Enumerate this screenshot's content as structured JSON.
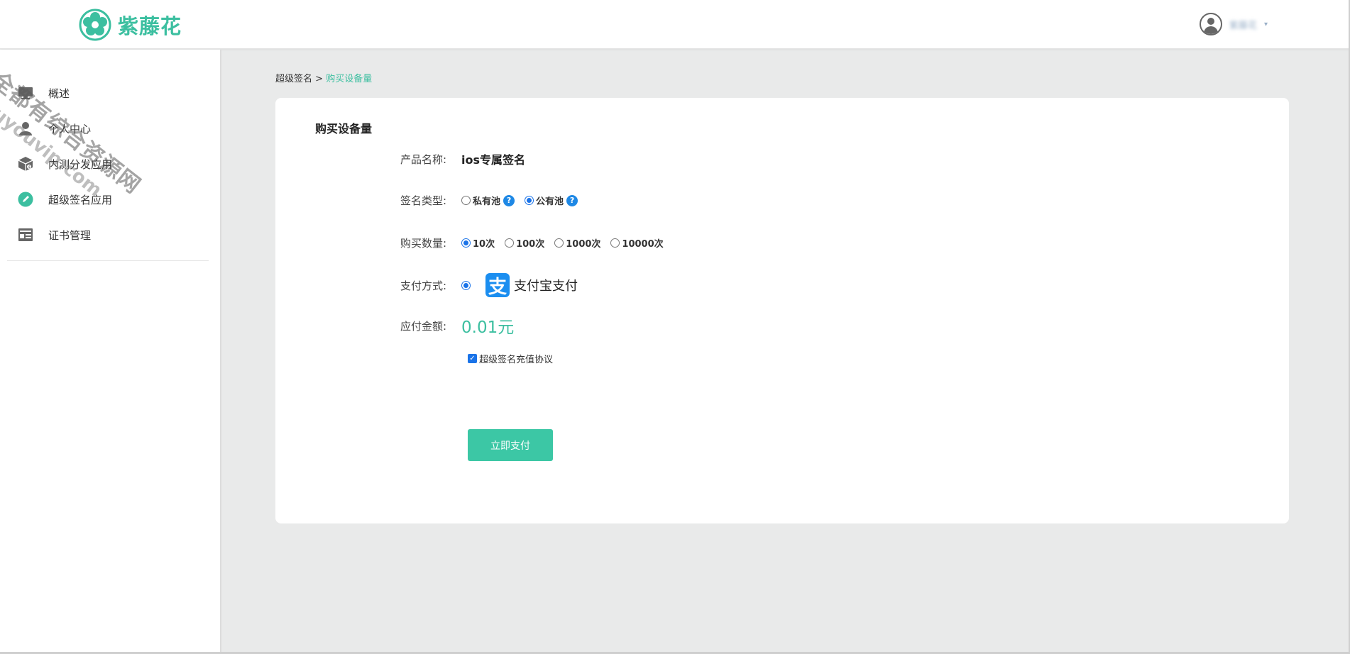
{
  "header": {
    "logo_text": "紫藤花",
    "username": "紫藤花",
    "caret": "▾"
  },
  "watermark": {
    "line1": "全都有综合资源网",
    "line2": "douyouvip.com"
  },
  "sidebar": {
    "items": [
      {
        "label": "概述",
        "icon": "monitor-icon"
      },
      {
        "label": "个人中心",
        "icon": "user-icon"
      },
      {
        "label": "内测分发应用",
        "icon": "box-icon"
      },
      {
        "label": "超级签名应用",
        "icon": "pen-icon"
      },
      {
        "label": "证书管理",
        "icon": "certificate-icon"
      }
    ]
  },
  "breadcrumb": {
    "parent": "超级签名",
    "separator": " > ",
    "current": "购买设备量"
  },
  "form": {
    "title": "购买设备量",
    "product_label": "产品名称:",
    "product_value": "ios专属签名",
    "sign_type_label": "签名类型:",
    "sign_type_options": [
      {
        "label": "私有池",
        "checked": false
      },
      {
        "label": "公有池",
        "checked": true
      }
    ],
    "help_glyph": "?",
    "quantity_label": "购买数量:",
    "quantity_options": [
      {
        "label": "10次",
        "checked": true
      },
      {
        "label": "100次",
        "checked": false
      },
      {
        "label": "1000次",
        "checked": false
      },
      {
        "label": "10000次",
        "checked": false
      }
    ],
    "payment_label": "支付方式:",
    "payment_logo_glyph": "支",
    "payment_text": "支付宝支付",
    "amount_label": "应付金额:",
    "amount_value": "0.01元",
    "agreement_text": "超级签名充值协议",
    "agreement_checked": true,
    "pay_button": "立即支付"
  },
  "colors": {
    "accent": "#3cbfa0",
    "radio_blue": "#1a73e8",
    "alipay_blue": "#1b8ef0",
    "button": "#3cc7a5"
  }
}
